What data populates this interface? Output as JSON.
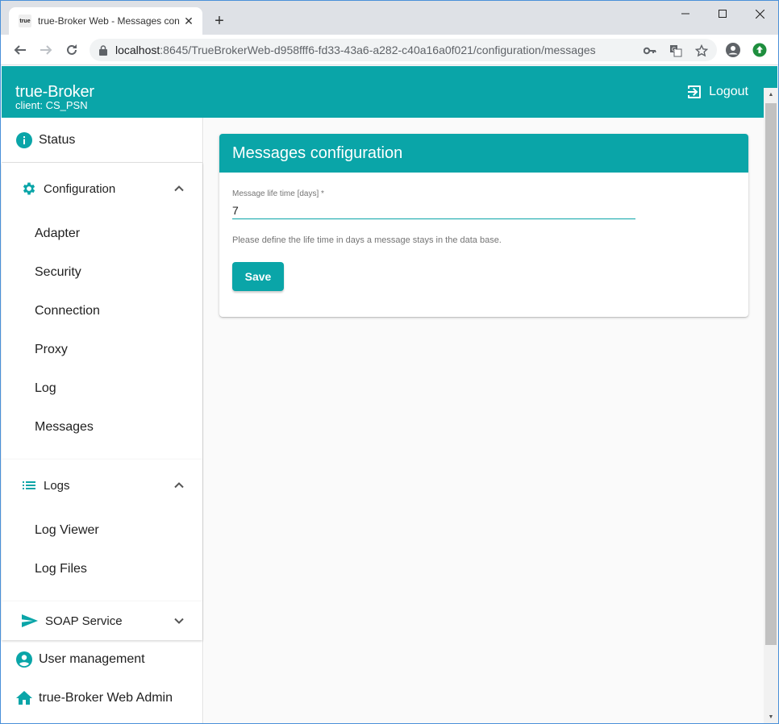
{
  "browser": {
    "tab_title": "true-Broker Web - Messages con",
    "favicon_text": "true",
    "url_host": "localhost",
    "url_rest": ":8645/TrueBrokerWeb-d958fff6-fd33-43a6-a282-c40a16a0f021/configuration/messages"
  },
  "header": {
    "title": "true-Broker",
    "client": "client: CS_PSN",
    "logout_label": "Logout"
  },
  "sidebar": {
    "status": "Status",
    "configuration": {
      "label": "Configuration",
      "items": [
        "Adapter",
        "Security",
        "Connection",
        "Proxy",
        "Log",
        "Messages"
      ]
    },
    "logs": {
      "label": "Logs",
      "items": [
        "Log Viewer",
        "Log Files"
      ]
    },
    "soap": "SOAP Service",
    "user_management": "User management",
    "admin": "true-Broker Web Admin"
  },
  "main": {
    "card_title": "Messages configuration",
    "field_label": "Message life time [days] *",
    "field_value": "7",
    "hint": "Please define the life time in days a message stays in the data base.",
    "save_label": "Save"
  },
  "colors": {
    "accent": "#0aa5a8"
  }
}
